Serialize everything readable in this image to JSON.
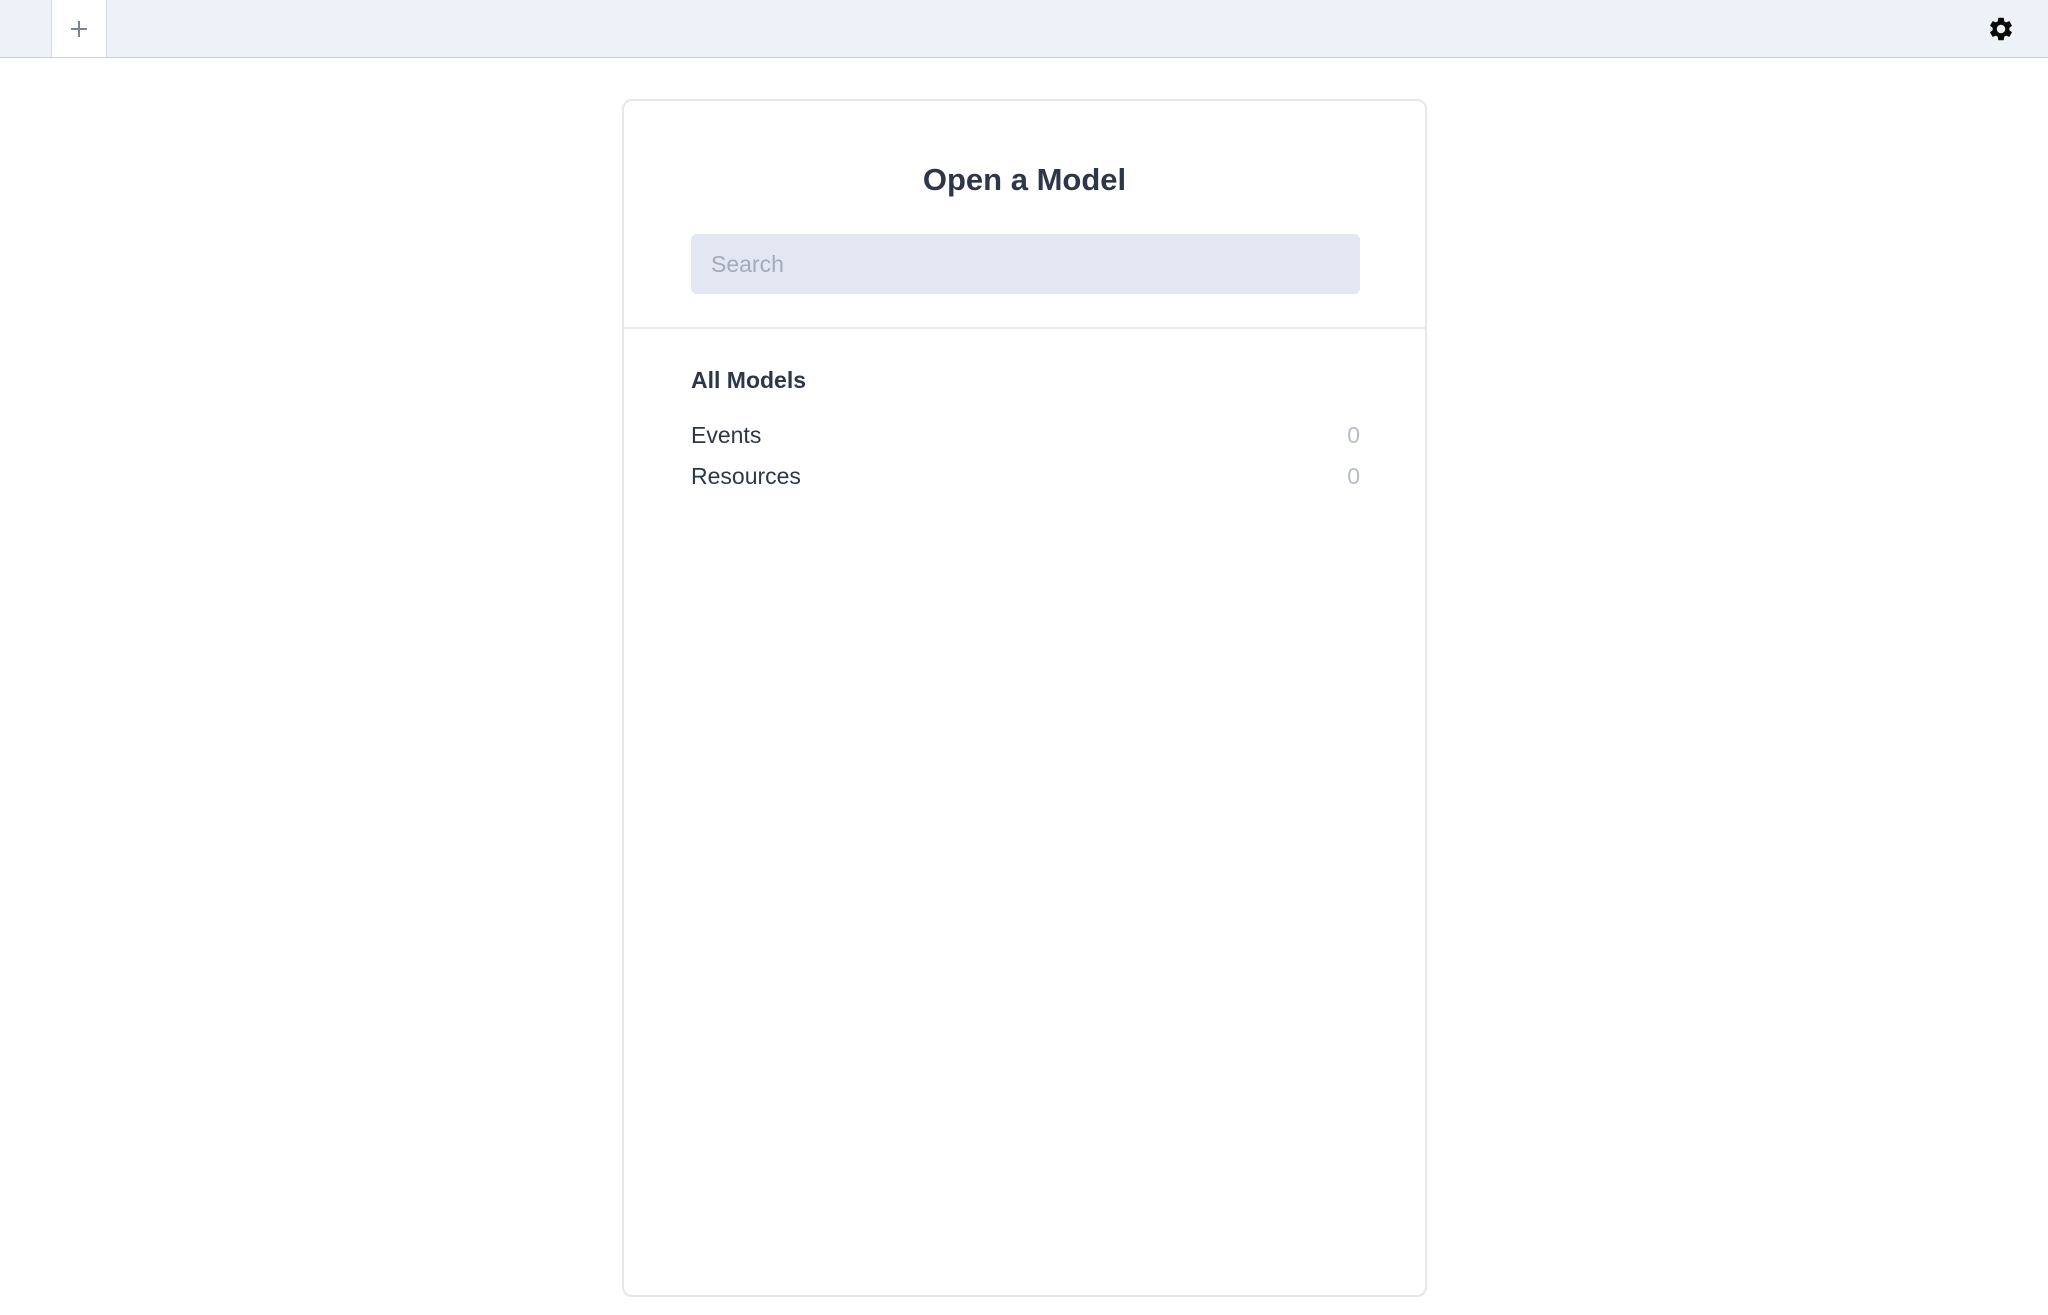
{
  "topbar": {
    "new_tab_icon": "plus-icon",
    "settings_icon": "gear-icon"
  },
  "panel": {
    "title": "Open a Model",
    "search": {
      "placeholder": "Search",
      "value": ""
    },
    "section_title": "All Models",
    "items": [
      {
        "label": "Events",
        "count": "0"
      },
      {
        "label": "Resources",
        "count": "0"
      }
    ]
  },
  "colors": {
    "topbar_bg": "#edf1f8",
    "search_bg": "#e3e7f1",
    "text": "#2d3748",
    "muted_count": "#b6bdc8"
  }
}
